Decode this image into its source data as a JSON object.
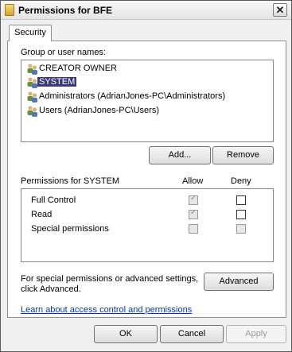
{
  "window": {
    "title": "Permissions for BFE",
    "close": "✕"
  },
  "tabs": [
    {
      "label": "Security"
    }
  ],
  "group": {
    "heading": "Group or user names:",
    "items": [
      {
        "label": "CREATOR OWNER",
        "selected": false
      },
      {
        "label": "SYSTEM",
        "selected": true
      },
      {
        "label": "Administrators (AdrianJones-PC\\Administrators)",
        "selected": false
      },
      {
        "label": "Users (AdrianJones-PC\\Users)",
        "selected": false
      }
    ],
    "add_label": "Add...",
    "remove_label": "Remove"
  },
  "permissions": {
    "heading": "Permissions for SYSTEM",
    "allow_header": "Allow",
    "deny_header": "Deny",
    "rows": [
      {
        "label": "Full Control",
        "allow": "checked-disabled",
        "deny": "unchecked"
      },
      {
        "label": "Read",
        "allow": "checked-disabled",
        "deny": "unchecked"
      },
      {
        "label": "Special permissions",
        "allow": "disabled",
        "deny": "disabled"
      }
    ]
  },
  "advanced": {
    "text_line1": "For special permissions or advanced settings,",
    "text_line2": "click Advanced.",
    "button_label": "Advanced"
  },
  "link_text": "Learn about access control and permissions",
  "footer": {
    "ok": "OK",
    "cancel": "Cancel",
    "apply": "Apply"
  },
  "colors": {
    "selection": "#3b3b7a",
    "link": "#0033cc"
  }
}
